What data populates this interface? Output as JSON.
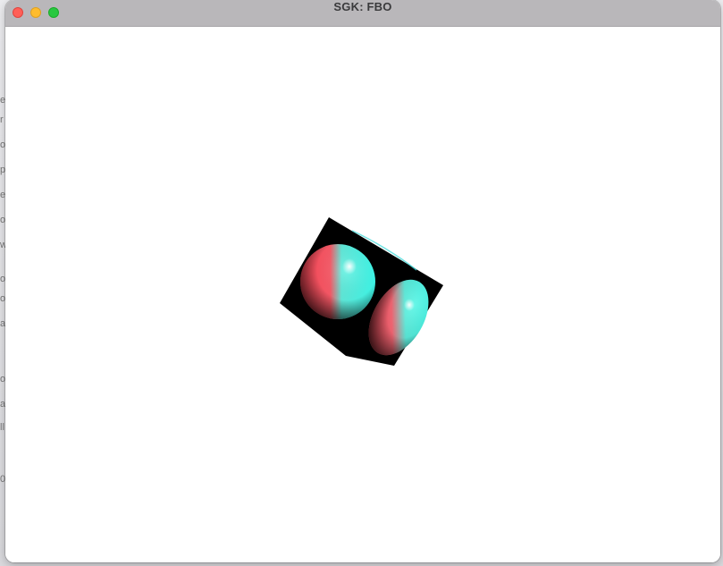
{
  "window": {
    "title": "SGK: FBO",
    "controls": {
      "close": "close-icon",
      "minimize": "minimize-icon",
      "zoom": "zoom-icon"
    }
  },
  "colors": {
    "titlebar": "#b9b7ba",
    "close": "#ff5f57",
    "minimize": "#febc2e",
    "zoom": "#28c840",
    "canvas": "#ffffff",
    "cube": "#000000",
    "sphere_red": "#ff3f55",
    "sphere_cyan": "#3ffff0"
  },
  "scene": {
    "object": "rotated-cube-with-spheres",
    "rendering": "fbo-render-to-texture"
  },
  "background_text": [
    "e",
    "r",
    "o",
    "p",
    "e",
    "o",
    "w",
    "o",
    "o",
    "a",
    "o",
    "a",
    "ll",
    "0"
  ]
}
